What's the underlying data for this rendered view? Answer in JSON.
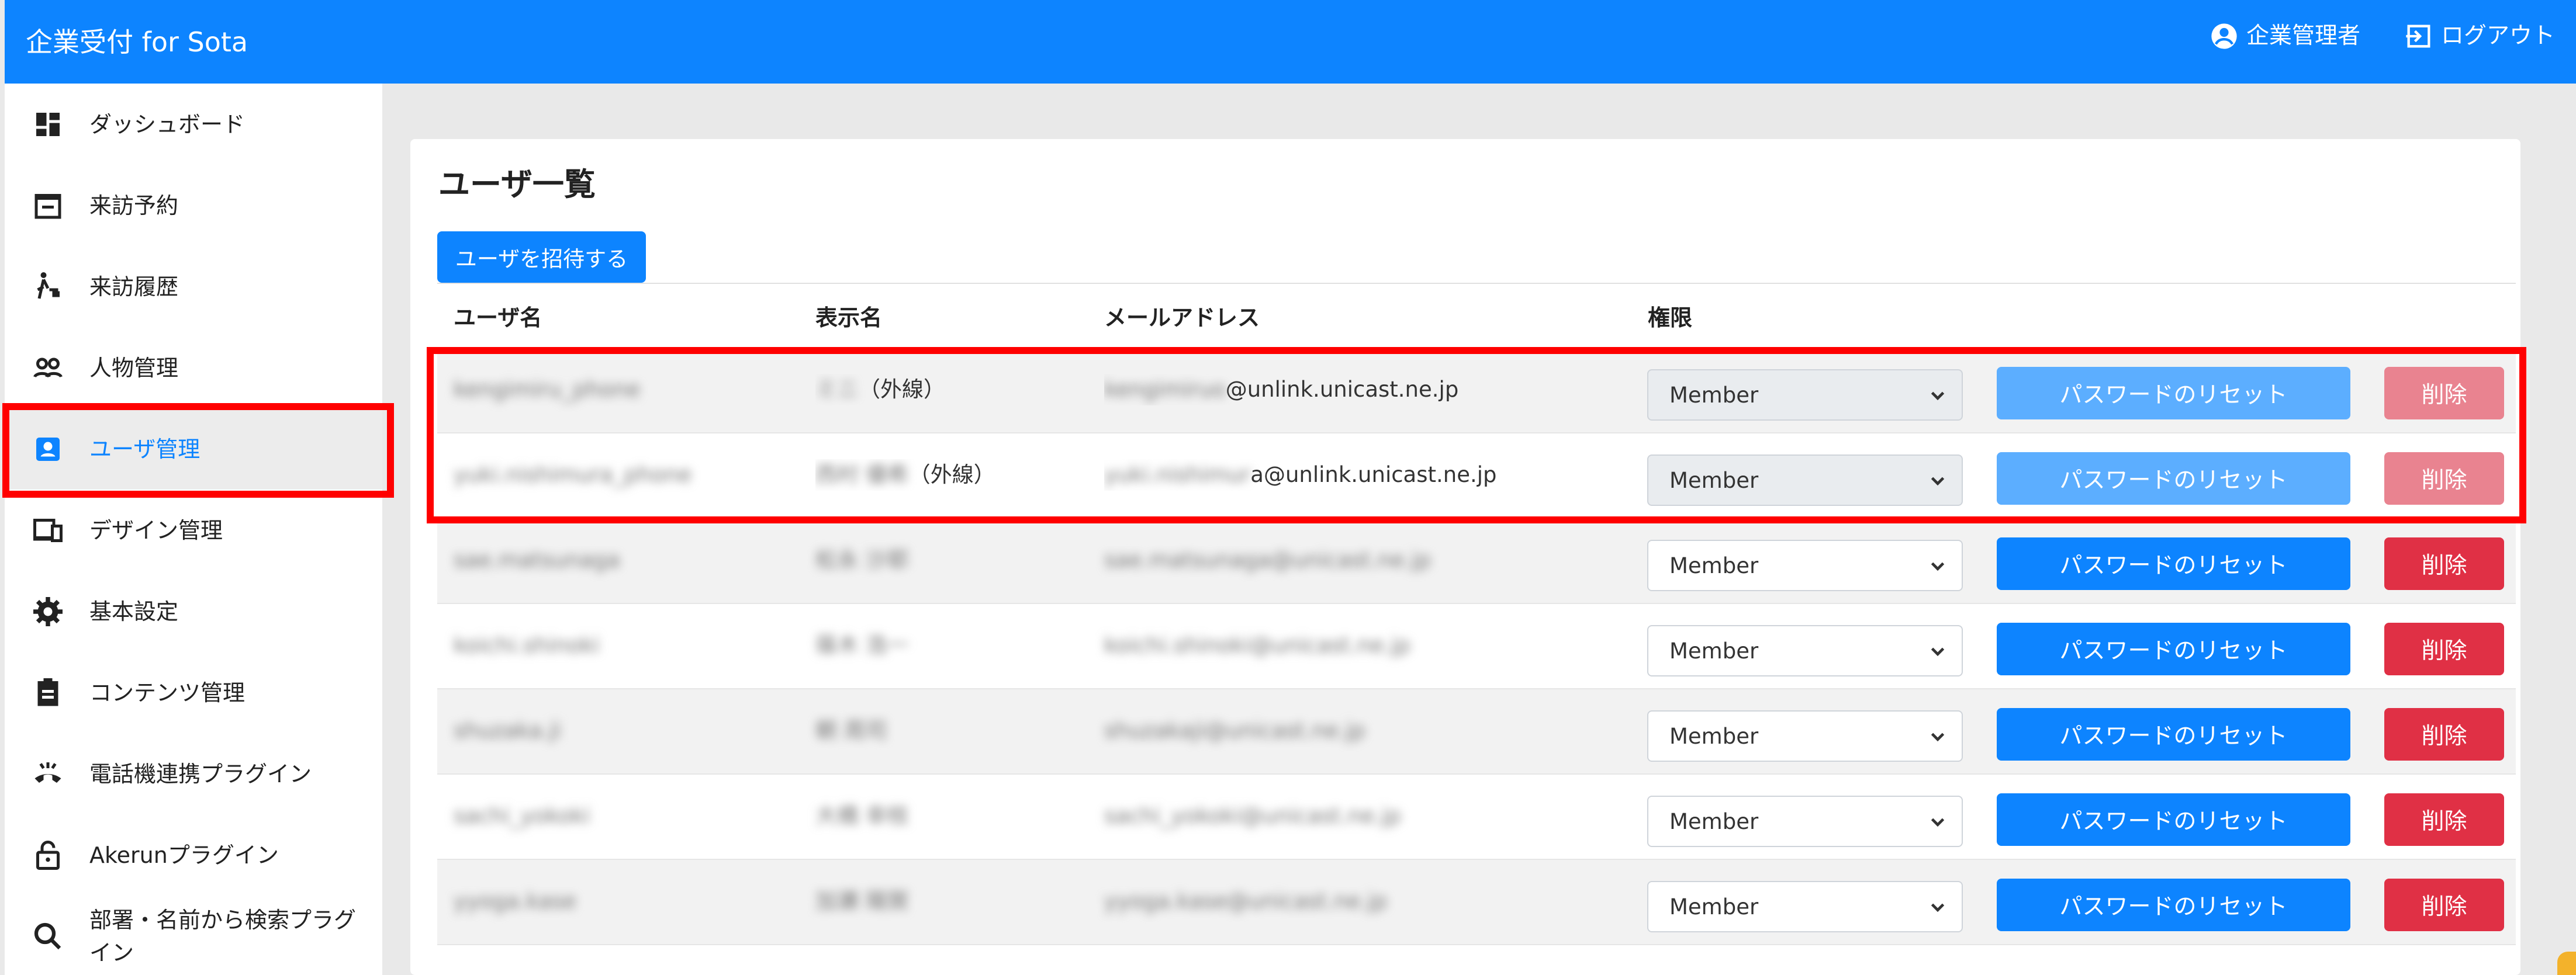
{
  "app": {
    "title": "企業受付 for Sota",
    "account_label": "企業管理者",
    "logout_label": "ログアウト"
  },
  "sidebar": {
    "items": [
      {
        "label": "ダッシュボード",
        "icon": "dashboard-icon"
      },
      {
        "label": "来訪予約",
        "icon": "calendar-icon"
      },
      {
        "label": "来訪履歴",
        "icon": "walking-person-icon"
      },
      {
        "label": "人物管理",
        "icon": "people-icon"
      },
      {
        "label": "ユーザ管理",
        "icon": "user-card-icon",
        "active": true
      },
      {
        "label": "デザイン管理",
        "icon": "devices-icon"
      },
      {
        "label": "基本設定",
        "icon": "gear-icon"
      },
      {
        "label": "コンテンツ管理",
        "icon": "clipboard-icon"
      },
      {
        "label": "電話機連携プラグイン",
        "icon": "phone-icon"
      },
      {
        "label": "Akerunプラグイン",
        "icon": "lock-icon"
      },
      {
        "label": "部署・名前から検索プラグイン",
        "icon": "search-icon"
      }
    ]
  },
  "main": {
    "title": "ユーザ一覧",
    "invite_label": "ユーザを招待する",
    "columns": [
      "ユーザ名",
      "表示名",
      "メールアドレス",
      "権限"
    ],
    "rows": [
      {
        "username": "kengimiru_phone",
        "display": "ミニ",
        "display_suffix": "（外線）",
        "email_hidden": "kengimiruo",
        "email_visible": "@unlink.unicast.ne.jp",
        "role": "Member",
        "reset_label": "パスワードのリセット",
        "delete_label": "削除",
        "disabled": true
      },
      {
        "username": "yuki.nishimura_phone",
        "display": "西村 優希",
        "display_suffix": "（外線）",
        "email_hidden": "yuki.nishimur",
        "email_visible": "a@unlink.unicast.ne.jp",
        "role": "Member",
        "reset_label": "パスワードのリセット",
        "delete_label": "削除",
        "disabled": true
      },
      {
        "username": "sae.matsunaga",
        "display": "松永 沙耶",
        "display_suffix": "",
        "email_hidden": "sae.matsunaga@unicast.ne.jp",
        "email_visible": "",
        "role": "Member",
        "reset_label": "パスワードのリセット",
        "delete_label": "削除",
        "disabled": false
      },
      {
        "username": "koichi.shinoki",
        "display": "篠木 浩一",
        "display_suffix": "",
        "email_hidden": "koichi.shinoki@unicast.ne.jp",
        "email_visible": "",
        "role": "Member",
        "reset_label": "パスワードのリセット",
        "delete_label": "削除",
        "disabled": false
      },
      {
        "username": "shuzaka.ji",
        "display": "朝 周司",
        "display_suffix": "",
        "email_hidden": "shuzakaji@unicast.ne.jp",
        "email_visible": "",
        "role": "Member",
        "reset_label": "パスワードのリセット",
        "delete_label": "削除",
        "disabled": false
      },
      {
        "username": "sachi_yokoki",
        "display": "大橋 幸枝",
        "display_suffix": "",
        "email_hidden": "sachi_yokoki@unicast.ne.jp",
        "email_visible": "",
        "role": "Member",
        "reset_label": "パスワードのリセット",
        "delete_label": "削除",
        "disabled": false
      },
      {
        "username": "yyoga.kase",
        "display": "加瀬 陽賀",
        "display_suffix": "",
        "email_hidden": "yyoga.kase@unicast.ne.jp",
        "email_visible": "",
        "role": "Member",
        "reset_label": "パスワードのリセット",
        "delete_label": "削除",
        "disabled": false
      }
    ]
  },
  "colors": {
    "primary": "#0d84ff",
    "danger": "#e03045",
    "highlight": "#ff0000"
  }
}
